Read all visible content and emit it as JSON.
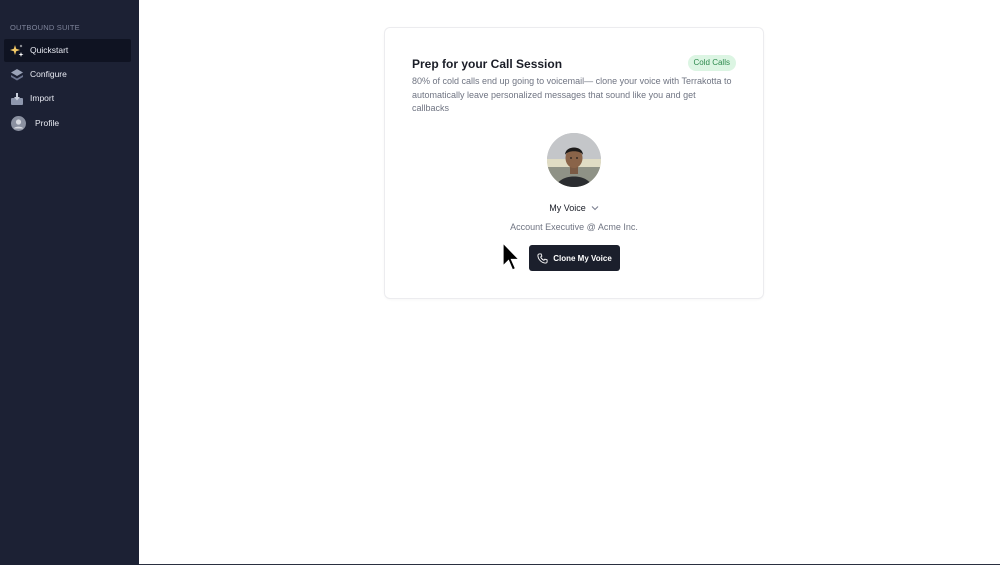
{
  "sidebar": {
    "section_label": "OUTBOUND SUITE",
    "items": [
      {
        "label": "Quickstart",
        "icon": "sparkles-icon",
        "active": true
      },
      {
        "label": "Configure",
        "icon": "layers-icon",
        "active": false
      },
      {
        "label": "Import",
        "icon": "inbox-download-icon",
        "active": false
      },
      {
        "label": "Profile",
        "icon": "user-avatar-icon",
        "active": false
      }
    ]
  },
  "card": {
    "title": "Prep for your Call Session",
    "badge": "Cold Calls",
    "description": "80% of cold calls end up going to voicemail— clone your voice with Terrakotta to automatically leave personalized messages that sound like you and get callbacks",
    "voice_select": "My Voice",
    "subtitle": "Account Executive @ Acme Inc.",
    "button_label": "Clone My Voice"
  },
  "colors": {
    "sidebar_bg": "#1c2134",
    "active_item_bg": "#0f1322",
    "badge_bg": "#dcf5e3",
    "badge_text": "#2e8a4e",
    "button_bg": "#1b1f2c"
  }
}
